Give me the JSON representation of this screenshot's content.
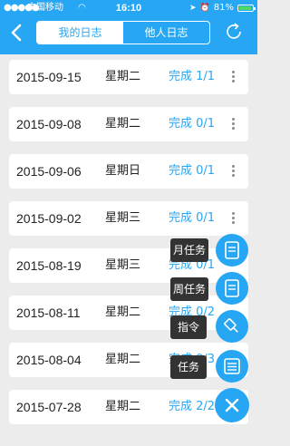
{
  "status_bar": {
    "carrier": "中国移动",
    "time": "16:10",
    "battery": "81%"
  },
  "header": {
    "tabs": [
      {
        "label": "我的日志"
      },
      {
        "label": "他人日志"
      }
    ]
  },
  "list": {
    "rows": [
      {
        "date": "2015-09-15",
        "weekday": "星期二",
        "status": "完成 1/1"
      },
      {
        "date": "2015-09-08",
        "weekday": "星期二",
        "status": "完成 0/1"
      },
      {
        "date": "2015-09-06",
        "weekday": "星期日",
        "status": "完成 0/1"
      },
      {
        "date": "2015-09-02",
        "weekday": "星期三",
        "status": "完成 0/1"
      },
      {
        "date": "2015-08-19",
        "weekday": "星期三",
        "status": "完成 0/1"
      },
      {
        "date": "2015-08-11",
        "weekday": "星期二",
        "status": "完成 0/2"
      },
      {
        "date": "2015-08-04",
        "weekday": "星期二",
        "status": "完成 0/3"
      },
      {
        "date": "2015-07-28",
        "weekday": "星期二",
        "status": "完成 2/2"
      }
    ]
  },
  "fab_menu": {
    "items": [
      {
        "label": "月任务",
        "icon": "document-icon"
      },
      {
        "label": "周任务",
        "icon": "document-icon"
      },
      {
        "label": "指令",
        "icon": "pin-icon"
      },
      {
        "label": "任务",
        "icon": "list-icon"
      }
    ],
    "close_icon": "close-icon"
  },
  "colors": {
    "accent": "#27a6f3",
    "background": "#ececec",
    "tooltip": "#333333"
  }
}
